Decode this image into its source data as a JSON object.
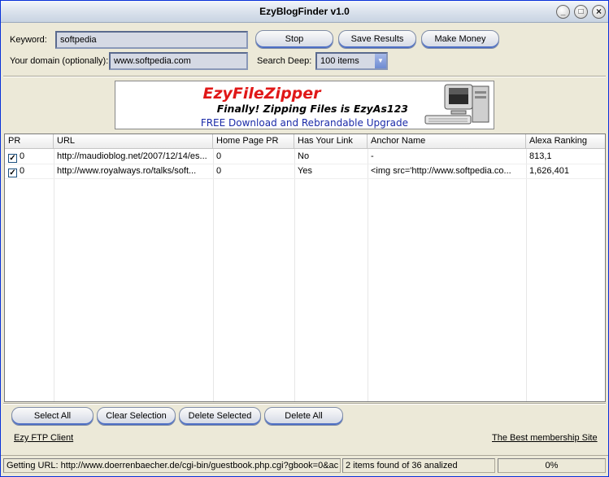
{
  "window": {
    "title": "EzyBlogFinder v1.0",
    "minimize": "_",
    "maximize": "□",
    "close": "×"
  },
  "form": {
    "keyword_label": "Keyword:",
    "keyword_value": "softpedia",
    "domain_label": "Your domain (optionally):",
    "domain_value": "www.softpedia.com",
    "search_deep_label": "Search Deep:",
    "search_deep_value": "100 items"
  },
  "buttons": {
    "stop": "Stop",
    "save_results": "Save Results",
    "make_money": "Make Money"
  },
  "banner": {
    "title": "EzyFileZipper",
    "tagline": "Finally! Zipping Files is EzyAs123",
    "cta": "FREE Download and Rebrandable Upgrade"
  },
  "table": {
    "columns": [
      "PR",
      "URL",
      "Home Page PR",
      "Has Your Link",
      "Anchor Name",
      "Alexa Ranking"
    ],
    "rows": [
      {
        "checked": true,
        "pr": "0",
        "url": "http://maudioblog.net/2007/12/14/es...",
        "home_pr": "0",
        "has_link": "No",
        "anchor": "-",
        "alexa": "813,1"
      },
      {
        "checked": true,
        "pr": "0",
        "url": "http://www.royalways.ro/talks/soft...",
        "home_pr": "0",
        "has_link": "Yes",
        "anchor": "<img src='http://www.softpedia.co...",
        "alexa": "1,626,401"
      }
    ]
  },
  "bottom_buttons": {
    "select_all": "Select All",
    "clear_selection": "Clear Selection",
    "delete_selected": "Delete Selected",
    "delete_all": "Delete All"
  },
  "links": {
    "ftp_client": "Ezy FTP Client",
    "membership": "The Best membership Site"
  },
  "status": {
    "getting_url": "Getting URL: http://www.doerrenbaecher.de/cgi-bin/guestbook.php.cgi?gbook=0&ac",
    "found": "2 items found of 36 analized",
    "progress": "0%",
    "progress_fraction": 0
  },
  "colors": {
    "link_blue": "#1a2aa8",
    "banner_red": "#e01818",
    "button_accent": "#4d6fc4"
  }
}
